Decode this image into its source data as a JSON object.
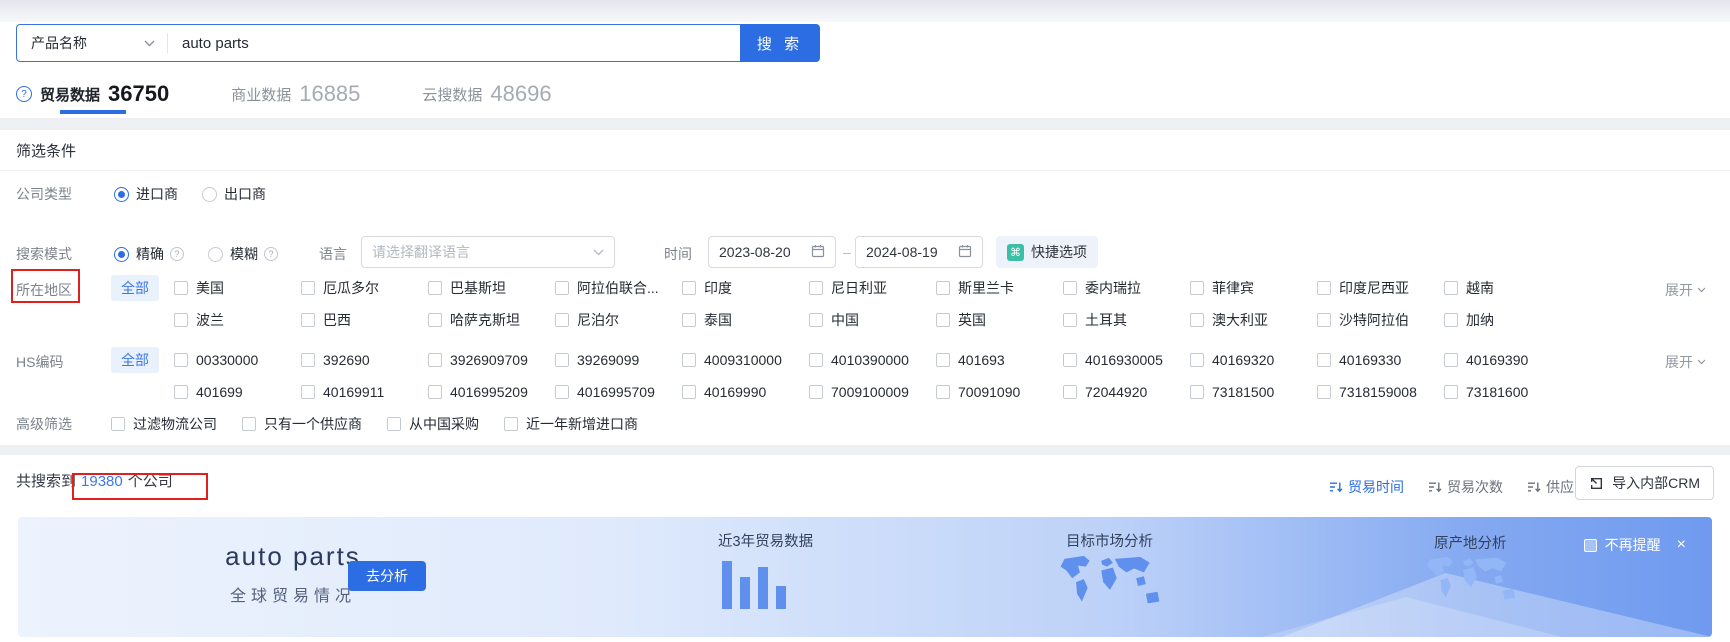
{
  "glyphs": {
    "question": "?",
    "command": "⌘",
    "close": "×",
    "dash": "–"
  },
  "search": {
    "category": "产品名称",
    "query": "auto parts",
    "button": "搜 索"
  },
  "tabs": [
    {
      "label": "贸易数据",
      "count": "36750"
    },
    {
      "label": "商业数据",
      "count": "16885"
    },
    {
      "label": "云搜数据",
      "count": "48696"
    }
  ],
  "filters": {
    "title": "筛选条件",
    "company_type": {
      "label": "公司类型",
      "option1": "进口商",
      "option2": "出口商",
      "selected": "进口商"
    },
    "search_mode": {
      "label": "搜索模式",
      "option1": "精确",
      "option2": "模糊",
      "selected": "精确"
    },
    "language": {
      "label": "语言",
      "placeholder": "请选择翻译语言"
    },
    "time": {
      "label": "时间",
      "start": "2023-08-20",
      "end": "2024-08-19"
    },
    "quick_option": "快捷选项",
    "region": {
      "label": "所在地区",
      "all": "全部",
      "expand": "展开",
      "row1": [
        "美国",
        "厄瓜多尔",
        "巴基斯坦",
        "阿拉伯联合...",
        "印度",
        "尼日利亚",
        "斯里兰卡",
        "委内瑞拉",
        "菲律宾",
        "印度尼西亚",
        "越南"
      ],
      "row2": [
        "波兰",
        "巴西",
        "哈萨克斯坦",
        "尼泊尔",
        "泰国",
        "中国",
        "英国",
        "土耳其",
        "澳大利亚",
        "沙特阿拉伯",
        "加纳"
      ]
    },
    "hs_code": {
      "label": "HS编码",
      "all": "全部",
      "expand": "展开",
      "row1": [
        "00330000",
        "392690",
        "3926909709",
        "39269099",
        "4009310000",
        "4010390000",
        "401693",
        "4016930005",
        "40169320",
        "40169330",
        "40169390"
      ],
      "row2": [
        "401699",
        "40169911",
        "4016995209",
        "4016995709",
        "40169990",
        "7009100009",
        "70091090",
        "72044920",
        "73181500",
        "7318159008",
        "73181600"
      ]
    },
    "advanced": {
      "label": "高级筛选",
      "options": [
        "过滤物流公司",
        "只有一个供应商",
        "从中国采购",
        "近一年新增进口商"
      ]
    }
  },
  "results": {
    "summary_prefix": "共搜索到",
    "summary_count": "19380",
    "summary_suffix": "个公司",
    "sorts": [
      {
        "label": "贸易时间"
      },
      {
        "label": "贸易次数"
      },
      {
        "label": "供应商数"
      }
    ],
    "crm_button": "导入内部CRM"
  },
  "banner": {
    "title": "auto parts",
    "subtitle": "全球贸易情况",
    "cta": "去分析",
    "feature1": "近3年贸易数据",
    "feature2": "目标市场分析",
    "feature3": "原产地分析",
    "dismiss": "不再提醒"
  },
  "colors": {
    "primary": "#2c6de4",
    "badge_bg": "#e9f1fd",
    "teal_icon": "#3cbfa7",
    "annotation": "#e0201c"
  }
}
